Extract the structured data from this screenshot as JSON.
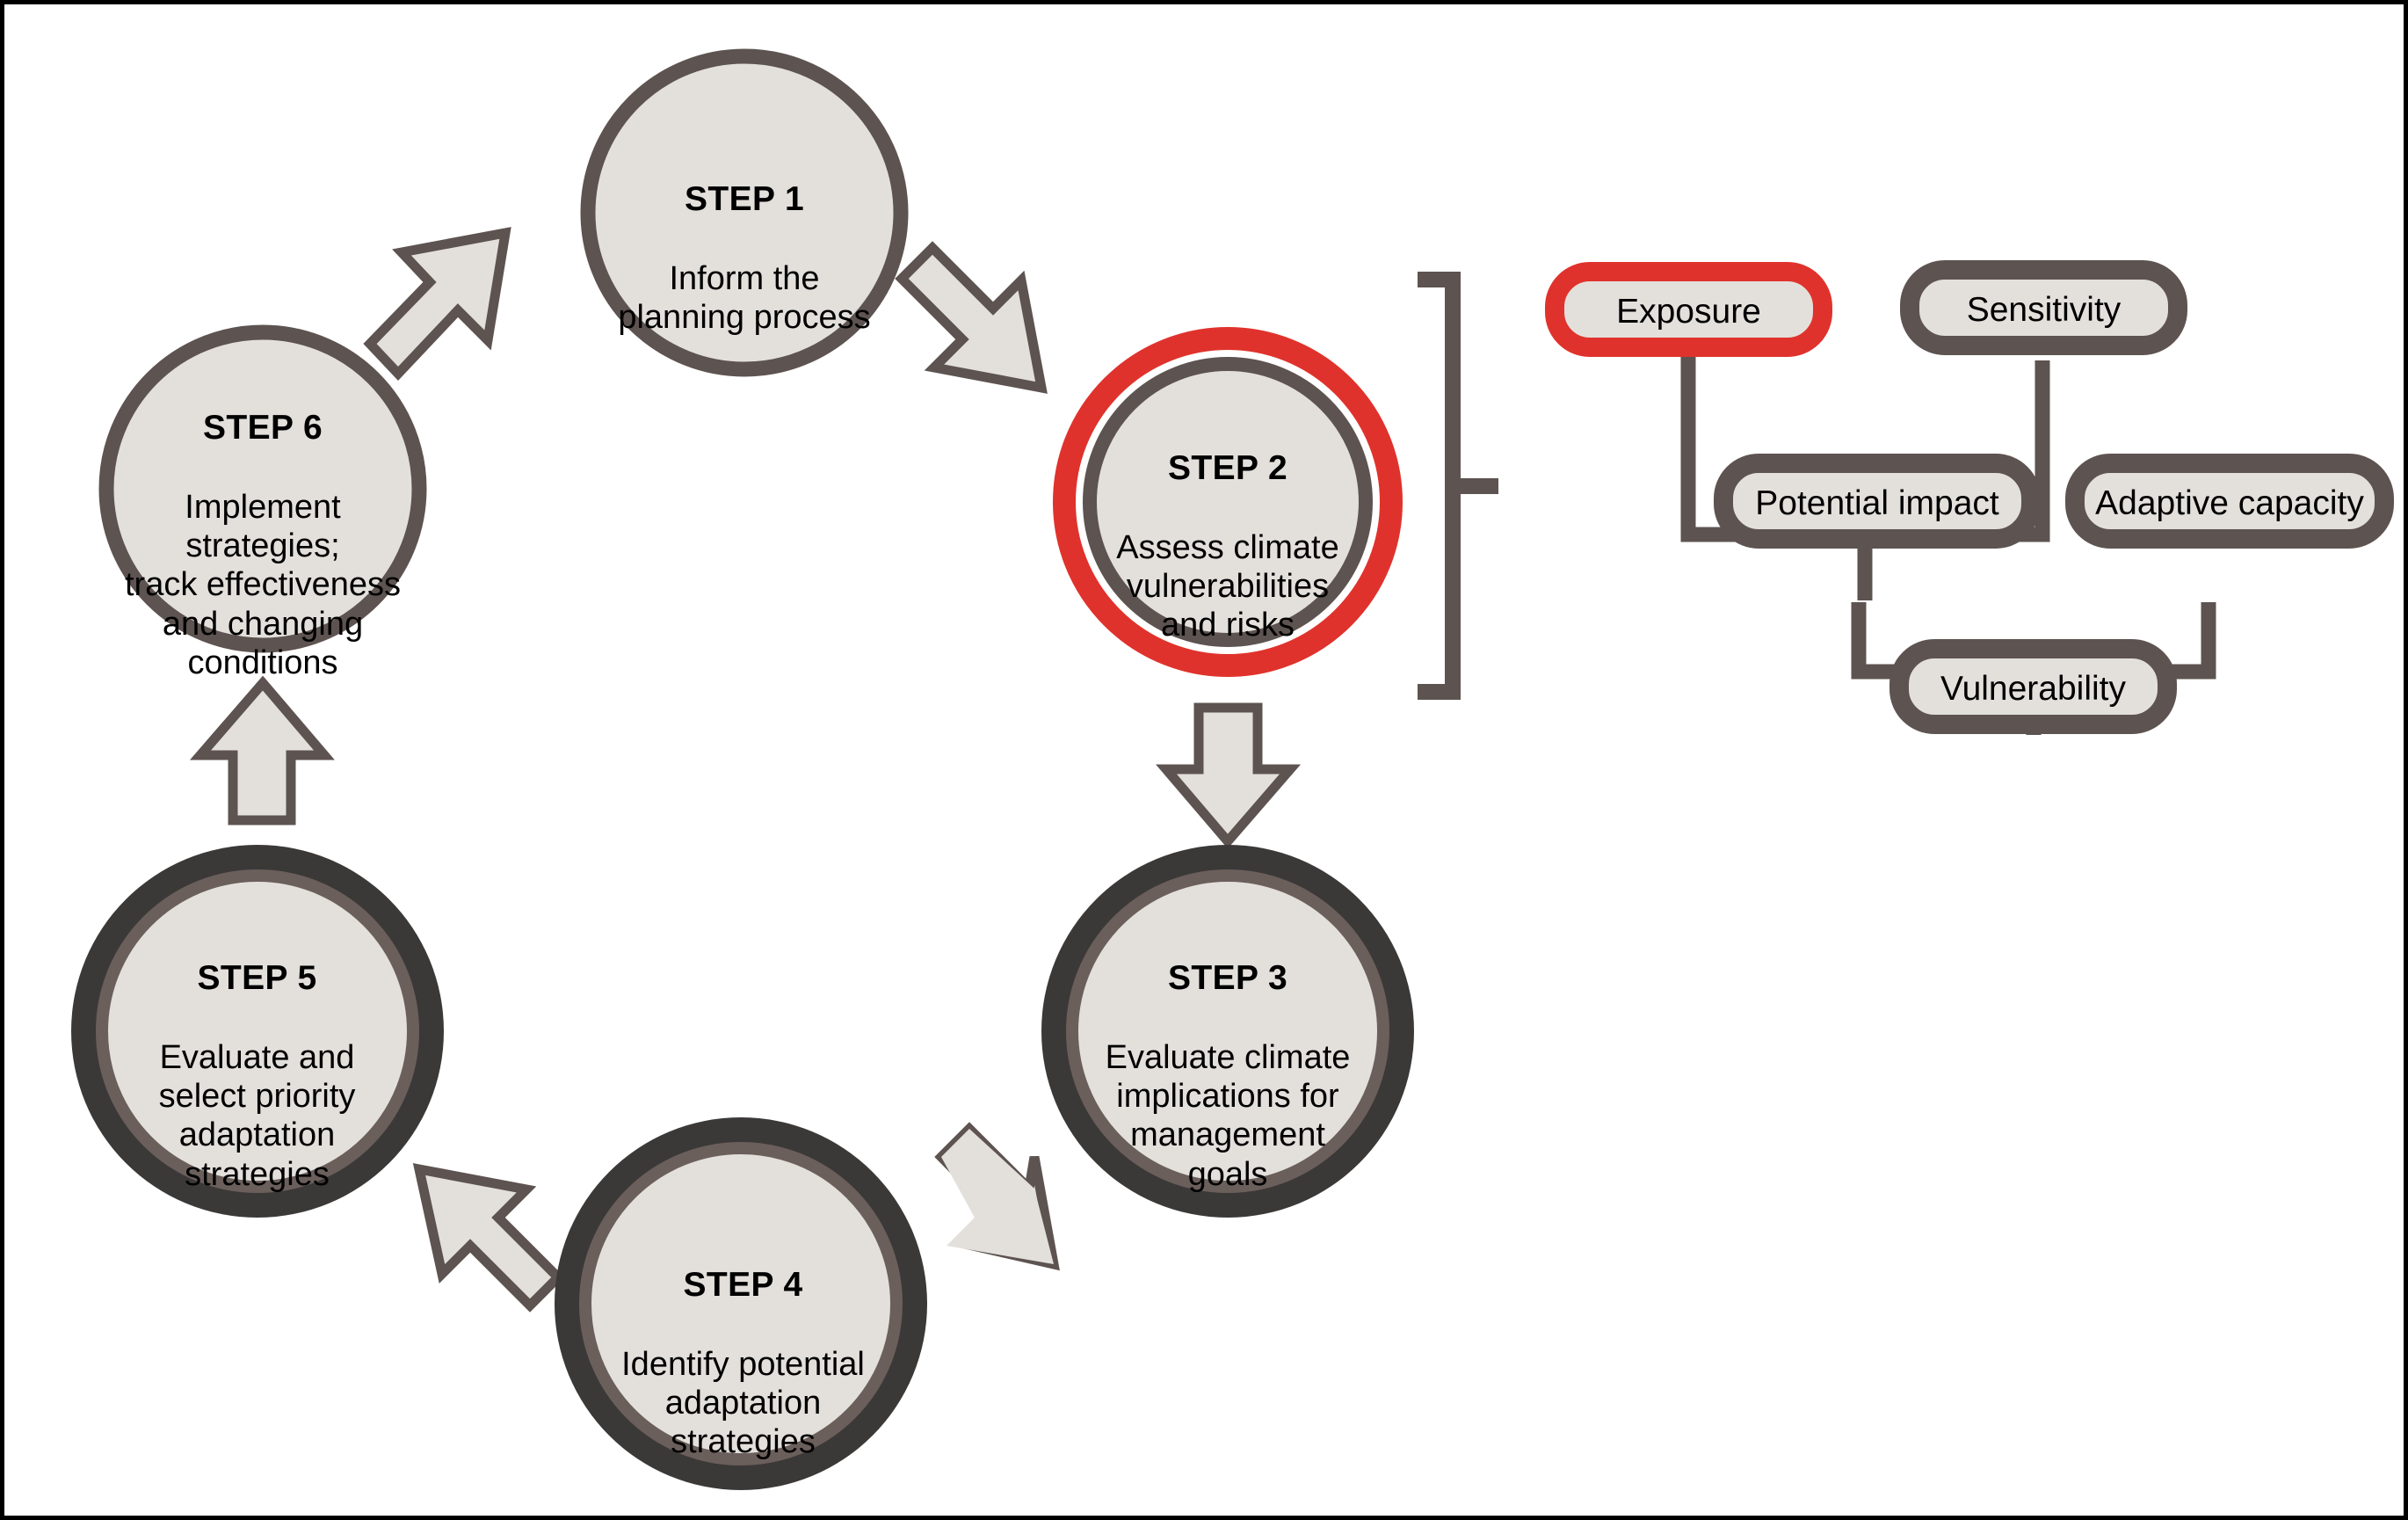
{
  "figure": {
    "title": "Climate adaptation planning cycle with vulnerability assessment framework",
    "background_color": "#ffffff",
    "border_color": "#000000"
  },
  "palette": {
    "fill_light": "#e3e0dc",
    "outline_gray": "#5d5350",
    "outline_dark": "#3b3938",
    "highlight_red": "#e0322c",
    "text_black": "#000000"
  },
  "cycle": {
    "steps": [
      {
        "id": "step-1",
        "title": "STEP 1",
        "body": "Inform the\nplanning process",
        "ring_style": "single-gray",
        "highlighted": false
      },
      {
        "id": "step-2",
        "title": "STEP 2",
        "body": "Assess climate\nvulnerabilities\nand risks",
        "ring_style": "red-highlight",
        "highlighted": true
      },
      {
        "id": "step-3",
        "title": "STEP 3",
        "body": "Evaluate climate\nimplications for\nmanagement\ngoals",
        "ring_style": "double-dark",
        "highlighted": false
      },
      {
        "id": "step-4",
        "title": "STEP 4",
        "body": "Identify potential\nadaptation\nstrategies",
        "ring_style": "double-dark",
        "highlighted": false
      },
      {
        "id": "step-5",
        "title": "STEP 5",
        "body": "Evaluate and\nselect priority\nadaptation\nstrategies",
        "ring_style": "double-dark",
        "highlighted": false
      },
      {
        "id": "step-6",
        "title": "STEP 6",
        "body": "Implement\nstrategies;\ntrack effectiveness\nand changing\nconditions",
        "ring_style": "single-gray",
        "highlighted": false
      }
    ],
    "arrows": [
      {
        "id": "arrow-step1-to-step2",
        "from": "STEP 1",
        "to": "STEP 2",
        "direction": "down-right"
      },
      {
        "id": "arrow-step2-to-step3",
        "from": "STEP 2",
        "to": "STEP 3",
        "direction": "down"
      },
      {
        "id": "arrow-step3-to-step4",
        "from": "STEP 3",
        "to": "STEP 4",
        "direction": "down-left"
      },
      {
        "id": "arrow-step4-to-step5",
        "from": "STEP 4",
        "to": "STEP 5",
        "direction": "up-left"
      },
      {
        "id": "arrow-step5-to-step6",
        "from": "STEP 5",
        "to": "STEP 6",
        "direction": "up"
      },
      {
        "id": "arrow-step6-to-step1",
        "from": "STEP 6",
        "to": "STEP 1",
        "direction": "up-right"
      }
    ]
  },
  "vulnerability_framework": {
    "bracket": {
      "id": "callout-bracket",
      "links": "STEP 2"
    },
    "boxes": [
      {
        "id": "box-exposure",
        "label": "Exposure",
        "highlighted": true
      },
      {
        "id": "box-sensitivity",
        "label": "Sensitivity",
        "highlighted": false
      },
      {
        "id": "box-potential-impact",
        "label": "Potential impact",
        "highlighted": false
      },
      {
        "id": "box-adaptive-capacity",
        "label": "Adaptive capacity",
        "highlighted": false
      },
      {
        "id": "box-vulnerability",
        "label": "Vulnerability",
        "highlighted": false
      }
    ],
    "connections": [
      {
        "from": "Exposure",
        "to": "Potential impact"
      },
      {
        "from": "Sensitivity",
        "to": "Potential impact"
      },
      {
        "from": "Potential impact",
        "to": "Vulnerability"
      },
      {
        "from": "Adaptive capacity",
        "to": "Vulnerability"
      }
    ]
  }
}
